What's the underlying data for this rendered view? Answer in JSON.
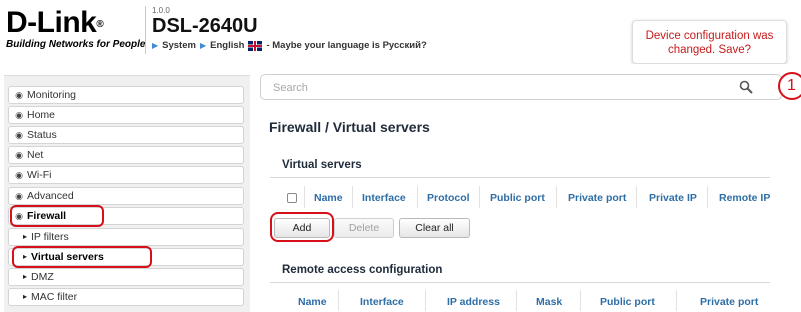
{
  "header": {
    "logo_text": "D-Link",
    "logo_reg": "®",
    "logo_tagline": "Building Networks for People",
    "version": "1.0.0",
    "model": "DSL-2640U",
    "breadcrumb_system": "System",
    "breadcrumb_language": "English",
    "language_hint": "- Maybe your language is Русский?"
  },
  "notice": {
    "line1": "Device configuration was",
    "line2": "changed. Save?"
  },
  "sidebar": {
    "items": [
      {
        "label": "Monitoring"
      },
      {
        "label": "Home"
      },
      {
        "label": "Status"
      },
      {
        "label": "Net"
      },
      {
        "label": "Wi-Fi"
      },
      {
        "label": "Advanced"
      },
      {
        "label": "Firewall"
      },
      {
        "label": "IP filters"
      },
      {
        "label": "Virtual servers"
      },
      {
        "label": "DMZ"
      },
      {
        "label": "MAC filter"
      }
    ]
  },
  "search": {
    "placeholder": "Search"
  },
  "badge": {
    "count": "1"
  },
  "page_title": "Firewall /  Virtual servers",
  "virtual_servers": {
    "title": "Virtual servers",
    "columns": [
      "Name",
      "Interface",
      "Protocol",
      "Public port",
      "Private port",
      "Private IP",
      "Remote IP"
    ],
    "buttons": {
      "add": "Add",
      "delete": "Delete",
      "clear_all": "Clear all"
    }
  },
  "remote_access": {
    "title": "Remote access configuration",
    "columns": [
      "Name",
      "Interface",
      "IP address",
      "Mask",
      "Public port",
      "Private port"
    ]
  },
  "colors": {
    "accent": "#2e6ea6",
    "highlight": "#d6101a",
    "notice": "#c51b1b"
  }
}
